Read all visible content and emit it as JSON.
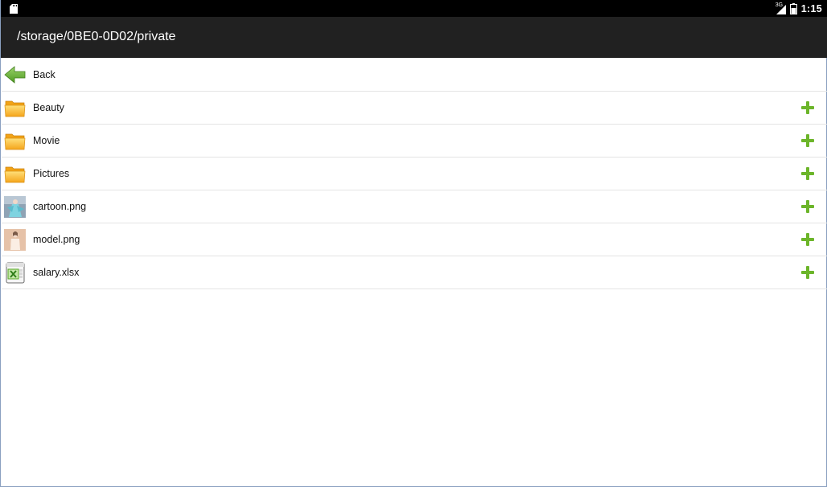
{
  "status_bar": {
    "network_type": "3G",
    "time": "1:15"
  },
  "title_bar": {
    "path": "/storage/0BE0-0D02/private"
  },
  "list": {
    "items": [
      {
        "label": "Back",
        "icon": "back-arrow-icon",
        "has_add": false
      },
      {
        "label": "Beauty",
        "icon": "folder-icon",
        "has_add": true
      },
      {
        "label": "Movie",
        "icon": "folder-icon",
        "has_add": true
      },
      {
        "label": "Pictures",
        "icon": "folder-icon",
        "has_add": true
      },
      {
        "label": "cartoon.png",
        "icon": "image-thumbnail-icon",
        "has_add": true
      },
      {
        "label": "model.png",
        "icon": "image-thumbnail-icon",
        "has_add": true
      },
      {
        "label": "salary.xlsx",
        "icon": "excel-file-icon",
        "has_add": true
      }
    ]
  },
  "colors": {
    "status_bar": "#000000",
    "title_bar": "#212121",
    "add_green": "#6cb52a",
    "folder_yellow": "#f7b52a"
  }
}
